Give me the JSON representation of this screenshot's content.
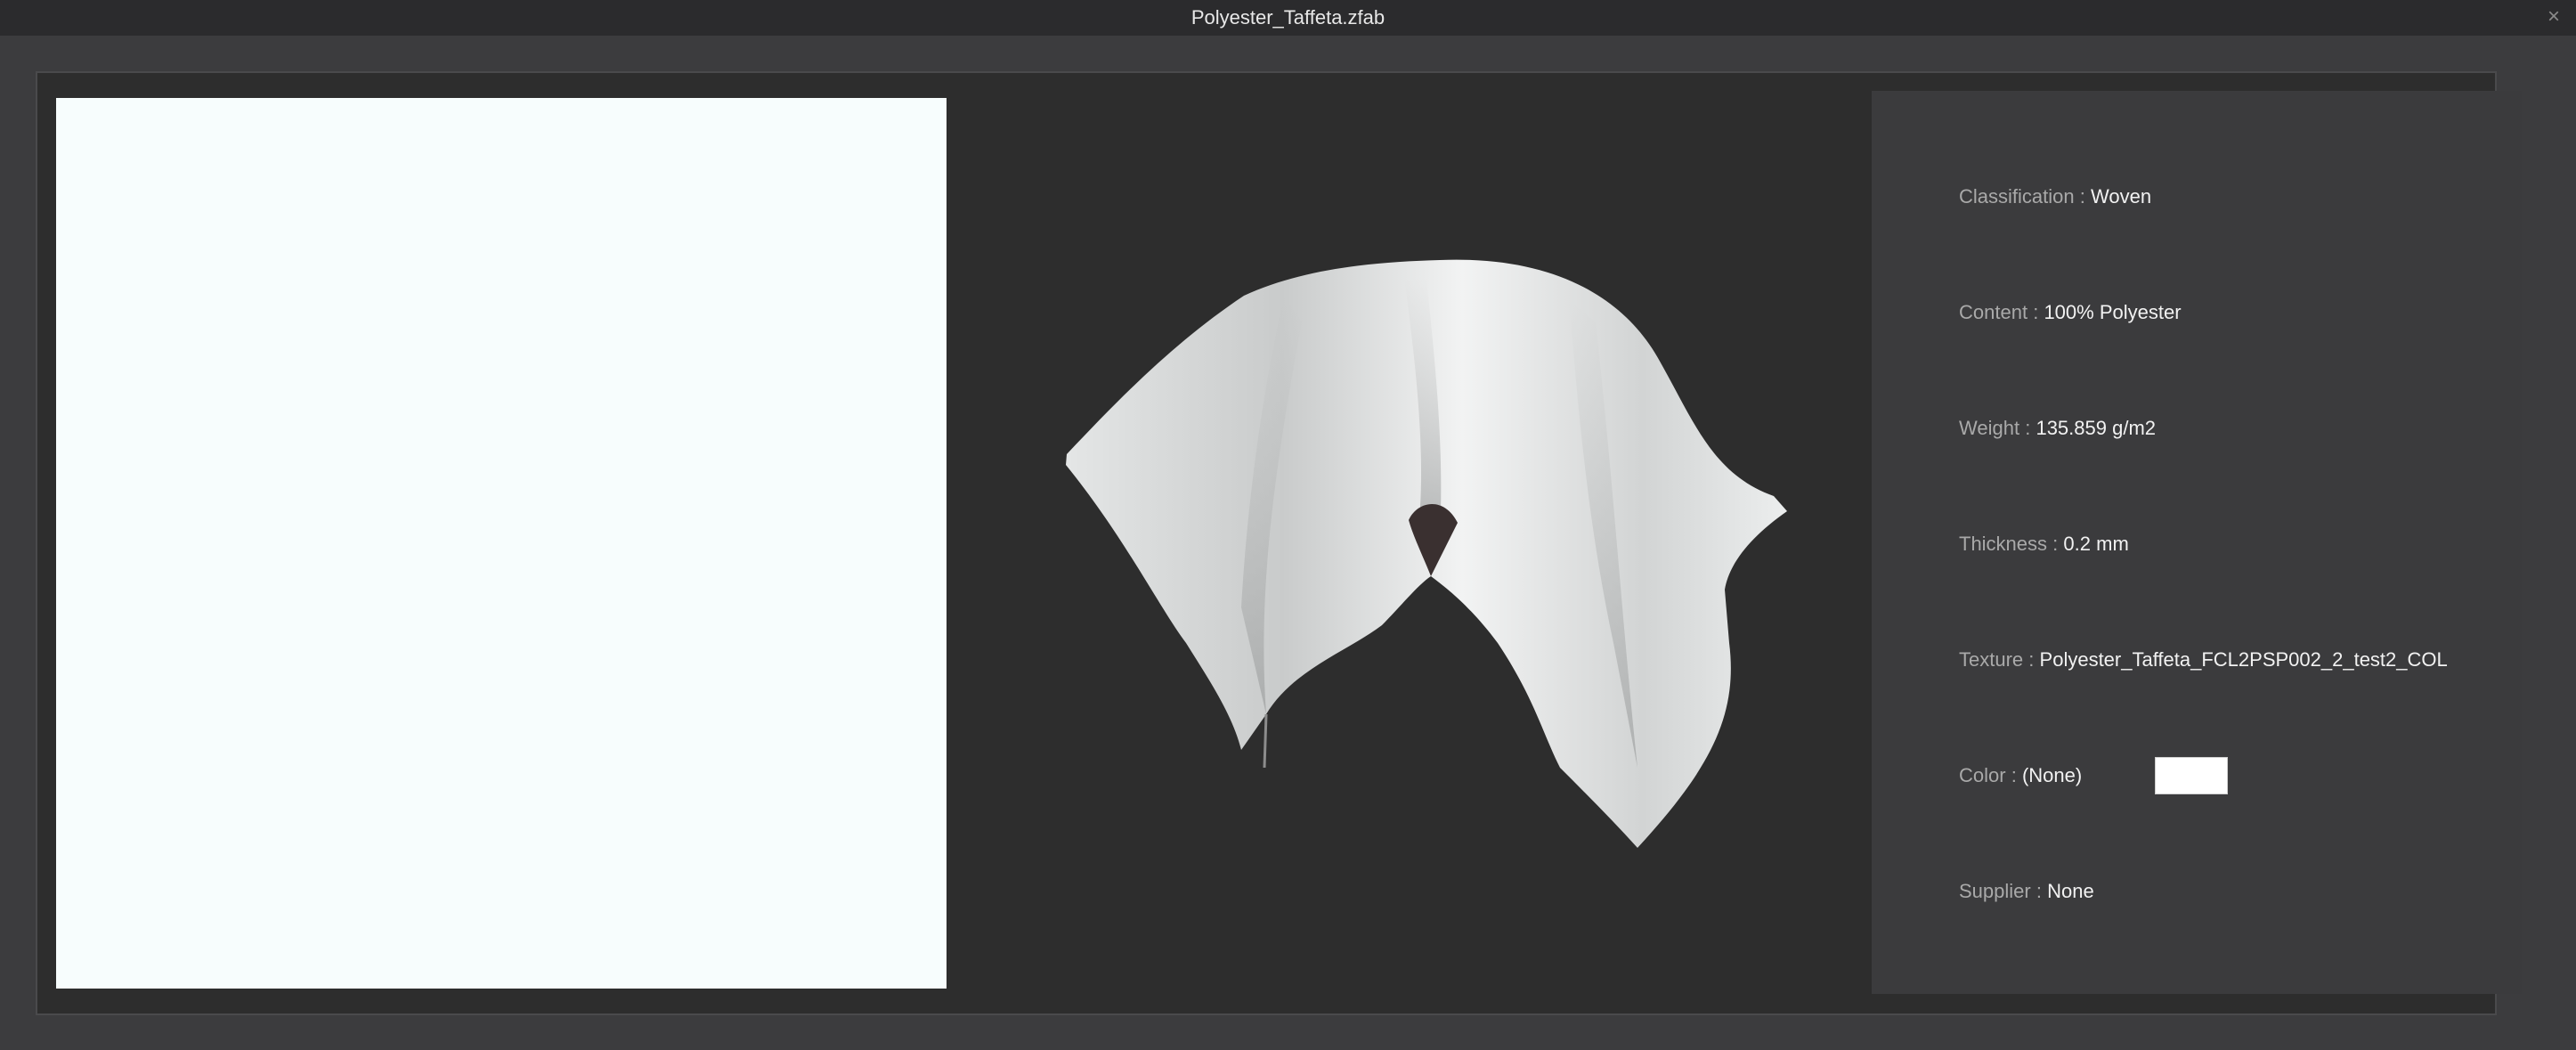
{
  "window": {
    "title": "Polyester_Taffeta.zfab",
    "close_glyph": "×"
  },
  "colors": {
    "swatch": "#f7fdfd",
    "fabric_color": "#ffffff"
  },
  "info": {
    "separator": ":",
    "classification": {
      "label": "Classification",
      "value": "Woven"
    },
    "content": {
      "label": "Content",
      "value": "100% Polyester"
    },
    "weight": {
      "label": "Weight",
      "value": "135.859 g/m2"
    },
    "thickness": {
      "label": "Thickness",
      "value": "0.2 mm"
    },
    "texture": {
      "label": "Texture",
      "value": "Polyester_Taffeta_FCL2PSP002_2_test2_COL"
    },
    "color": {
      "label": "Color",
      "value": "(None)"
    },
    "supplier": {
      "label": "Supplier",
      "value": "None"
    }
  }
}
